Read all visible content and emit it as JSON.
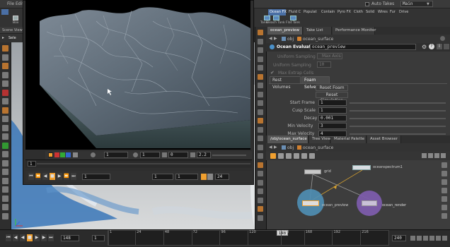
{
  "menu": {
    "items": [
      "File",
      "Edit"
    ],
    "auto_takes": "Auto Takes",
    "desktop": "Main"
  },
  "shelf_tabs": [
    "Ocean FX",
    "Fluid C",
    "Populat",
    "Contain",
    "Pyro FX",
    "Cloth",
    "Solid",
    "Wires",
    "Fur",
    "Drive"
  ],
  "left_shelf": {
    "box_label": "Box",
    "scene_view_tab": "Scene View",
    "select_label": "Sele"
  },
  "shelf_tools": [
    "Tank",
    "Beach Tank",
    "Flat Tank"
  ],
  "pane_tabs": [
    "ocean_preview",
    "Take List",
    "Performance Monitor"
  ],
  "path": {
    "obj": "obj",
    "node": "ocean_surface"
  },
  "params": {
    "node_type": "Ocean Evaluate",
    "node_name": "ocean_preview",
    "uniform_sampling": "Uniform Sampling",
    "max_axis": "Max Axis",
    "uniform_sampling2": "Uniform Sampling",
    "uniform_sampling2_value": "10",
    "max_extrap": "Max Extrap Cells",
    "subtabs": [
      "Rest Volumes",
      "Foam Solver"
    ],
    "reset_foam": "Reset Foam",
    "reset_simulation": "Reset Simulation",
    "fields": [
      {
        "label": "Start Frame",
        "value": "1",
        "slider": true
      },
      {
        "label": "Cusp Scale",
        "value": "1",
        "slider": true
      },
      {
        "label": "Decay",
        "value": "0.001",
        "slider": true
      },
      {
        "label": "Min Velocity",
        "value": "3",
        "slider": true
      },
      {
        "label": "Max Velocity",
        "value": "4",
        "slider": true
      }
    ]
  },
  "network": {
    "tabs": [
      "/obj/ocean_surface",
      "Tree View",
      "Material Palette",
      "Asset Browser"
    ],
    "path_obj": "obj",
    "path_node": "ocean_surface",
    "nodes": {
      "grid": "grid",
      "spectrum": "oceanspectrum1",
      "preview": "ocean_preview",
      "render": "ocean_render"
    }
  },
  "flipbook": {
    "field1": "1",
    "field2": "1",
    "field3": "0",
    "field4": "1",
    "zoom": "2.2",
    "frame_field": "1",
    "play_field1": "1",
    "play_field2": "1",
    "play_field3": "1",
    "play_end": "24"
  },
  "timeline": {
    "start": "148",
    "start2": "1",
    "ticks": [
      "1",
      "24",
      "48",
      "72",
      "96",
      "120",
      "148",
      "168",
      "192",
      "216"
    ],
    "current": "148",
    "end": "240"
  },
  "colors": {
    "accent": "#4a6fa5",
    "node_preview_ring": "#4f8fb5",
    "node_render": "#7c5cab",
    "selected": "#f0a030"
  }
}
